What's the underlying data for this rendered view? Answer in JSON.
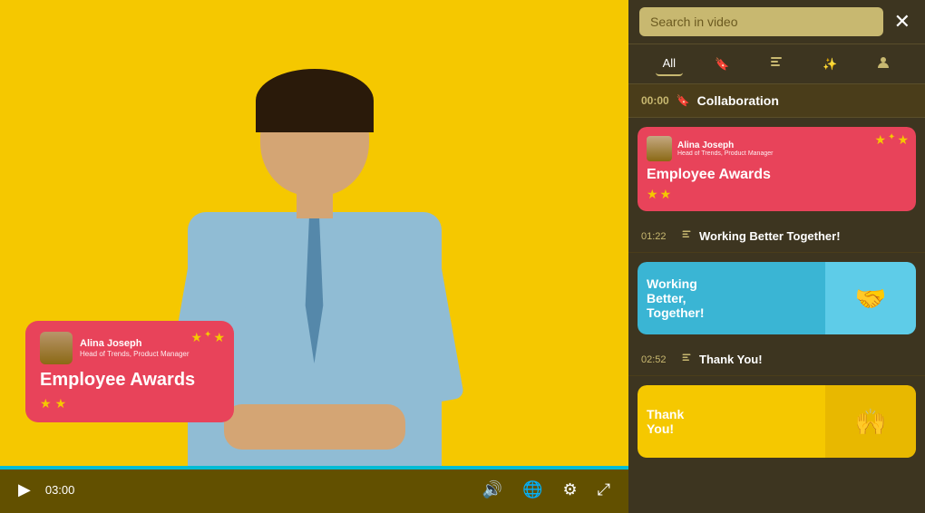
{
  "video": {
    "time_current": "03:00",
    "progress_pct": 100
  },
  "overlay_card": {
    "name": "Alina Joseph",
    "role": "Head of Trends, Product Manager",
    "title": "Employee Awards"
  },
  "search": {
    "placeholder": "Search in video",
    "value": ""
  },
  "close_label": "✕",
  "filter_tabs": [
    {
      "id": "all",
      "label": "All",
      "active": true
    },
    {
      "id": "bookmark",
      "label": "🔖",
      "active": false
    },
    {
      "id": "chapter",
      "label": "📋",
      "active": false
    },
    {
      "id": "highlight",
      "label": "✨",
      "active": false
    },
    {
      "id": "person",
      "label": "👤",
      "active": false
    }
  ],
  "sections": [
    {
      "time": "00:00",
      "icon": "🔖",
      "title": "Collaboration",
      "slides": [
        {
          "type": "red",
          "name": "Alina Joseph",
          "role": "Head of Trends, Product Manager",
          "title": "Employee Awards",
          "stars": [
            "★",
            "★",
            "✦"
          ],
          "stars_bottom": [
            "★",
            "★"
          ]
        }
      ]
    },
    {
      "time": "01:22",
      "icon": "📋",
      "title": "Working Better Together!",
      "slides": [
        {
          "type": "blue",
          "title": "Working Better, Together!",
          "img_text": "🤝"
        }
      ]
    },
    {
      "time": "02:52",
      "icon": "📋",
      "title": "Thank You!",
      "slides": [
        {
          "type": "yellow",
          "title": "Thank You!",
          "img_text": "🙌"
        }
      ]
    }
  ],
  "controls": {
    "play_icon": "▶",
    "volume_icon": "🔊",
    "globe_icon": "🌐",
    "settings_icon": "⚙",
    "fullscreen_icon": "⤢"
  }
}
